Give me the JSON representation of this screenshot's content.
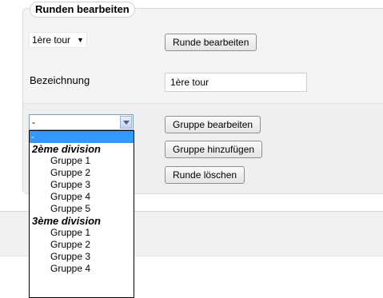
{
  "fieldset": {
    "legend": "Runden bearbeiten"
  },
  "round": {
    "selected": "1ère tour"
  },
  "buttons": {
    "edit_round": "Runde bearbeiten",
    "edit_group": "Gruppe bearbeiten",
    "add_group": "Gruppe hinzufügen",
    "delete_round": "Runde löschen"
  },
  "name_field": {
    "label": "Bezeichnung",
    "value": "1ère tour"
  },
  "group_select": {
    "selected": "-",
    "options": [
      {
        "type": "option",
        "label": "-",
        "selected": true
      },
      {
        "type": "group",
        "label": "2ème division"
      },
      {
        "type": "option",
        "label": "Gruppe 1"
      },
      {
        "type": "option",
        "label": "Gruppe 2"
      },
      {
        "type": "option",
        "label": "Gruppe 3"
      },
      {
        "type": "option",
        "label": "Gruppe 4"
      },
      {
        "type": "option",
        "label": "Gruppe 5"
      },
      {
        "type": "group",
        "label": "3ème division"
      },
      {
        "type": "option",
        "label": "Gruppe 1"
      },
      {
        "type": "option",
        "label": "Gruppe 2"
      },
      {
        "type": "option",
        "label": "Gruppe 3"
      },
      {
        "type": "option",
        "label": "Gruppe 4"
      }
    ]
  },
  "colors": {
    "highlight": "#3399ff",
    "panel": "#f4f4f4"
  }
}
